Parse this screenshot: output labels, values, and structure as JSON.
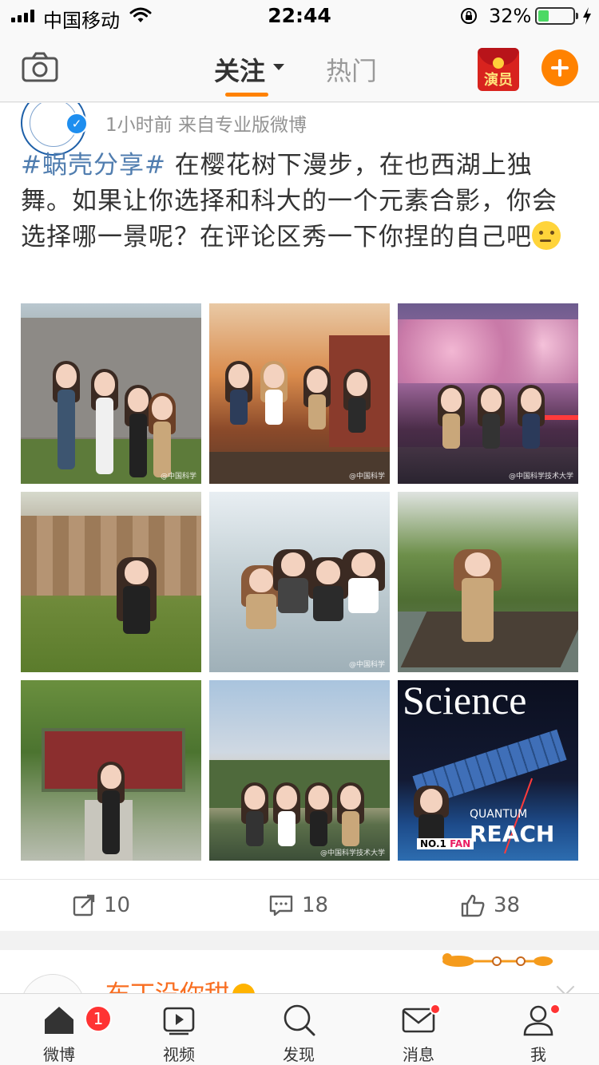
{
  "status_bar": {
    "carrier": "中国移动",
    "time": "22:44",
    "battery_percent": "32%",
    "battery_level": 0.32
  },
  "top_nav": {
    "tab_follow": "关注",
    "tab_hot": "热门",
    "redpacket_label": "演员",
    "accent": "#ff8200"
  },
  "post": {
    "meta": "1小时前  来自专业版微博",
    "hashtag": "#蜗壳分享#",
    "text": " 在樱花树下漫步，在也西湖上独舞。如果让你选择和科大的一个元素合影，你会选择哪一景呢？在评论区秀一下你捏的自己吧",
    "hashtag_color": "#507daf",
    "images": [
      {
        "icon": "campus-gate-photo",
        "watermark": "@中国科学"
      },
      {
        "icon": "autumn-trees-photo",
        "watermark": "@中国科学"
      },
      {
        "icon": "cherry-blossom-night-photo",
        "watermark": "@中国科学技术大学"
      },
      {
        "icon": "campus-building-lawn-photo",
        "watermark": ""
      },
      {
        "icon": "snow-group-selfie-photo",
        "watermark": "@中国科学"
      },
      {
        "icon": "lake-boardwalk-photo",
        "watermark": ""
      },
      {
        "icon": "ivy-building-photo",
        "watermark": ""
      },
      {
        "icon": "sky-gate-photo",
        "watermark": "@中国科学技术大学"
      },
      {
        "icon": "science-magazine-cover-photo",
        "watermark": ""
      }
    ],
    "science_cover": {
      "title": "Science",
      "headline1": "QUANTUM",
      "headline2": "REACH",
      "tag": "NO.1",
      "fan": "FAN"
    },
    "actions": {
      "repost": "10",
      "comments": "18",
      "likes": "38"
    }
  },
  "next_post": {
    "name": "布丁没你甜"
  },
  "tab_bar": {
    "weibo": "微博",
    "weibo_badge": "1",
    "video": "视频",
    "discover": "发现",
    "messages": "消息",
    "me": "我"
  }
}
